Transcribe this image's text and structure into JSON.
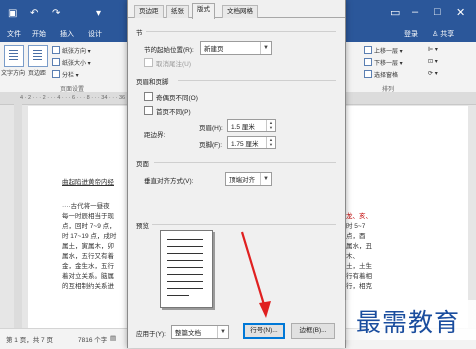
{
  "menu": {
    "tabs": [
      "文件",
      "开始",
      "插入",
      "设计"
    ],
    "right_tabs": [
      "登录",
      "共享"
    ]
  },
  "ribbon": {
    "big": [
      "文字方向",
      "页边距"
    ],
    "small_left": [
      "纸张方向",
      "纸张大小",
      "分栏"
    ],
    "group_left": "页面设置",
    "small_right": [
      "上移一层",
      "下移一层",
      "选择窗格"
    ],
    "group_right": "排列"
  },
  "ruler_ticks": "4 · 2 · · · 2 · · · 4 · · · 6 · · · 8 · · · 34 · · · 36 · · 40",
  "document": {
    "lines": [
      "曲起陷进黄帝内经",
      "",
      "····古代将一昼夜",
      "每一时辰相当于现",
      "点，回时 7~9 点，",
      "时 17~19 点，戌时",
      "属土，寅属木，卯",
      "属水，五行又有着",
      "金，金生水，五行",
      "着对立关系。脑属",
      "的互相制约关系进"
    ],
    "right_lines": [
      "龙、亥、",
      "时 5~7",
      "点，酉",
      "属水，丑",
      "木、",
      "土，土生",
      "行有着相",
      "行，相克"
    ]
  },
  "status": {
    "page": "第 1 页，共 7 页",
    "words": "7816 个字"
  },
  "dialog": {
    "tabs": [
      "页边距",
      "纸张",
      "版式",
      "文档网格"
    ],
    "active_tab": "版式",
    "section": {
      "title": "节",
      "start_label": "节的起始位置(R):",
      "start_value": "新建页",
      "suppress_endnotes": "取消尾注(U)"
    },
    "headers_footers": {
      "title": "页眉和页脚",
      "odd_even": "奇偶页不同(O)",
      "first_page": "首页不同(P)",
      "from_edge": "距边界:",
      "header_label": "页眉(H):",
      "header_value": "1.5 厘米",
      "footer_label": "页脚(F):",
      "footer_value": "1.75 厘米"
    },
    "page": {
      "title": "页面",
      "valign_label": "垂直对齐方式(V):",
      "valign_value": "顶端对齐"
    },
    "preview": {
      "title": "预览"
    },
    "apply": {
      "label": "应用于(Y):",
      "value": "整篇文档"
    },
    "buttons": {
      "line_numbers": "行号(N)...",
      "borders": "边框(B)..."
    }
  },
  "watermark": "最需教育",
  "colors": {
    "title_bar": "#2b579a",
    "arrow": "#e02020",
    "focus": "#0078d7"
  }
}
